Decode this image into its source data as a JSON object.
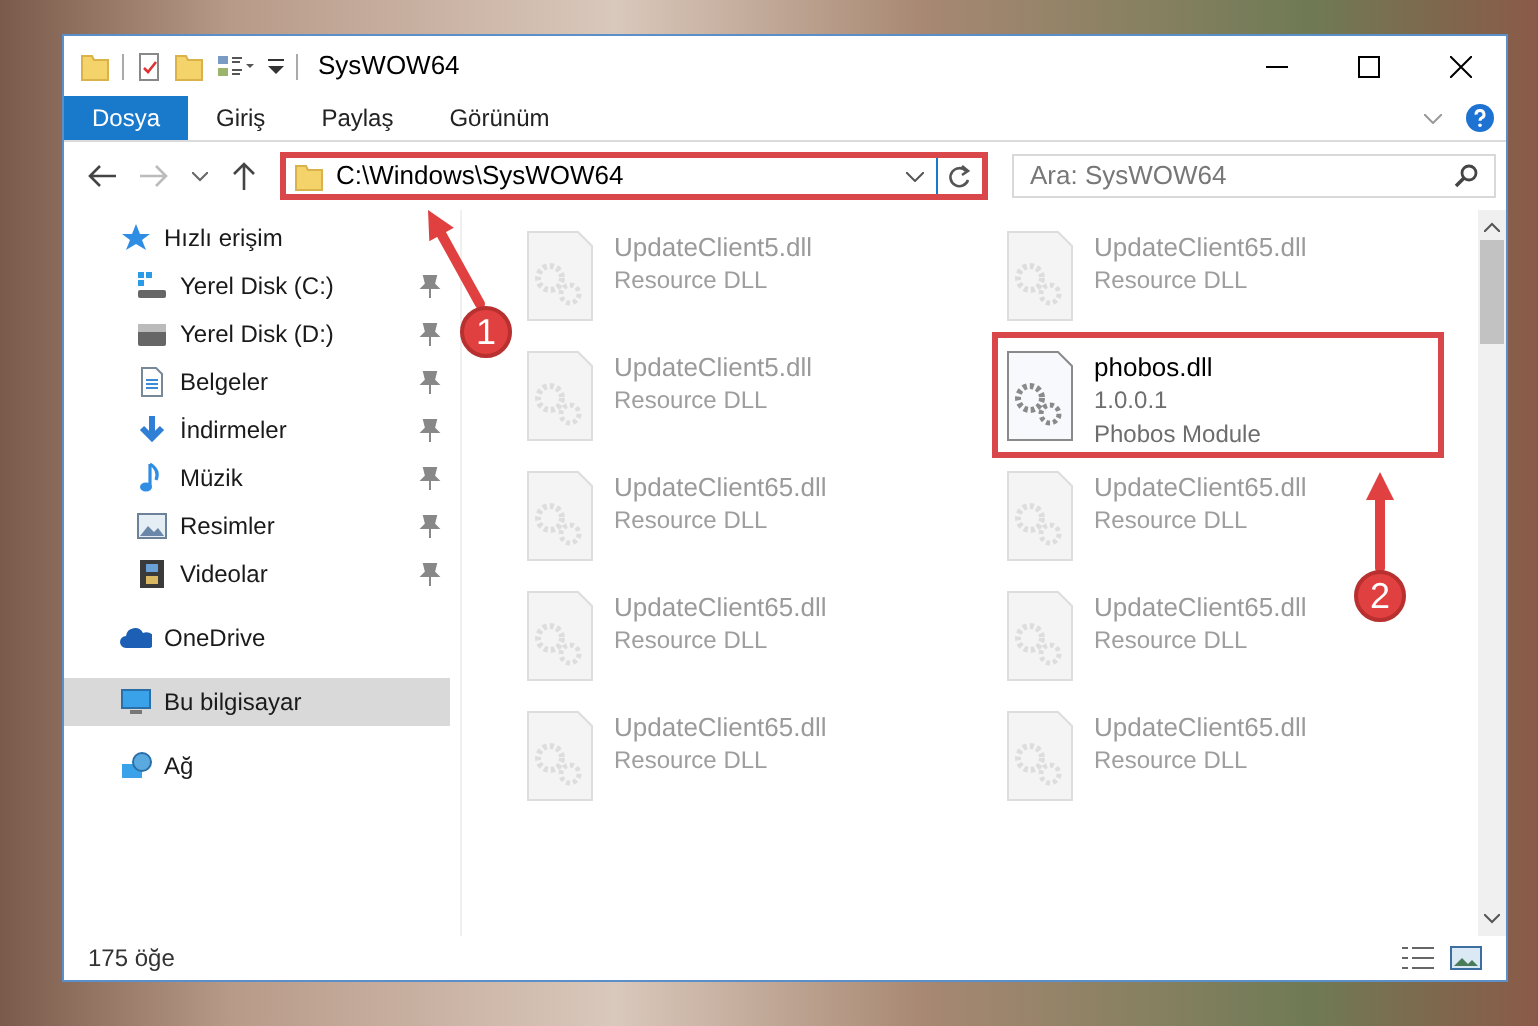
{
  "window": {
    "title": "SysWOW64"
  },
  "ribbon_tabs": [
    {
      "label": "Dosya",
      "selected": true
    },
    {
      "label": "Giriş",
      "selected": false
    },
    {
      "label": "Paylaş",
      "selected": false
    },
    {
      "label": "Görünüm",
      "selected": false
    }
  ],
  "address_bar": {
    "value": "C:\\Windows\\SysWOW64",
    "highlighted": true
  },
  "search": {
    "placeholder": "Ara: SysWOW64"
  },
  "sidebar": {
    "items": [
      {
        "label": "Hızlı erişim",
        "selected": false,
        "children": [
          {
            "label": "Yerel Disk (C:)",
            "selected": false,
            "pinned": true
          },
          {
            "label": "Yerel Disk (D:)",
            "selected": false,
            "pinned": true
          },
          {
            "label": "Belgeler",
            "selected": false,
            "pinned": true
          },
          {
            "label": "İndirmeler",
            "selected": false,
            "pinned": true
          },
          {
            "label": "Müzik",
            "selected": false,
            "pinned": true
          },
          {
            "label": "Resimler",
            "selected": false,
            "pinned": true
          },
          {
            "label": "Videolar",
            "selected": false,
            "pinned": true
          }
        ]
      },
      {
        "label": "OneDrive",
        "selected": false
      },
      {
        "label": "Bu bilgisayar",
        "selected": true
      },
      {
        "label": "Ağ",
        "selected": false
      }
    ]
  },
  "files": [
    {
      "name": "UpdateClient5.dll",
      "lines": [
        "Resource DLL"
      ],
      "kind": "faded",
      "highlighted": false
    },
    {
      "name": "UpdateClient65.dll",
      "lines": [
        "Resource DLL"
      ],
      "kind": "faded",
      "highlighted": false
    },
    {
      "name": "UpdateClient5.dll",
      "lines": [
        "Resource DLL"
      ],
      "kind": "faded",
      "highlighted": false
    },
    {
      "name": "phobos.dll",
      "lines": [
        "1.0.0.1",
        "Phobos Module"
      ],
      "kind": "normal",
      "highlighted": true
    },
    {
      "name": "UpdateClient65.dll",
      "lines": [
        "Resource DLL"
      ],
      "kind": "faded",
      "highlighted": false
    },
    {
      "name": "UpdateClient65.dll",
      "lines": [
        "Resource DLL"
      ],
      "kind": "faded",
      "highlighted": false
    },
    {
      "name": "UpdateClient65.dll",
      "lines": [
        "Resource DLL"
      ],
      "kind": "faded",
      "highlighted": false
    },
    {
      "name": "UpdateClient65.dll",
      "lines": [
        "Resource DLL"
      ],
      "kind": "faded",
      "highlighted": false
    },
    {
      "name": "UpdateClient65.dll",
      "lines": [
        "Resource DLL"
      ],
      "kind": "faded",
      "highlighted": false
    },
    {
      "name": "UpdateClient65.dll",
      "lines": [
        "Resource DLL"
      ],
      "kind": "faded",
      "highlighted": false
    }
  ],
  "status_bar": {
    "item_count": "175 öğe"
  },
  "callouts": [
    {
      "label": "1"
    },
    {
      "label": "2"
    }
  ]
}
